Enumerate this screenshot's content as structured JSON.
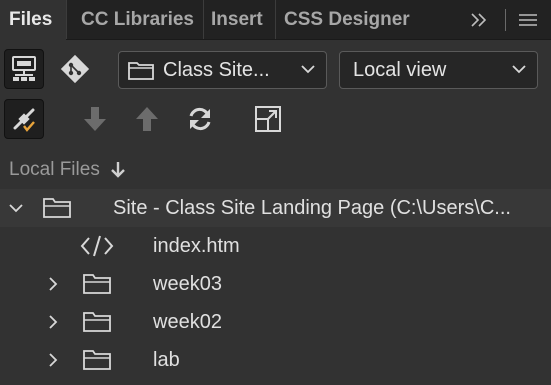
{
  "tabs": [
    {
      "label": "Files",
      "active": true
    },
    {
      "label": "CC Libraries",
      "active": false
    },
    {
      "label": "Insert",
      "active": false
    },
    {
      "label": "CSS Designer",
      "active": false
    }
  ],
  "tab_controls": {
    "expand_icon": "double-chevron-right-icon",
    "menu_icon": "hamburger-menu-icon"
  },
  "toolbar": {
    "site_select": {
      "value": "Class Site..."
    },
    "view_select": {
      "value": "Local view"
    },
    "icons": [
      "connect-server-icon",
      "git-icon",
      "expand-collapse-icon",
      "get-files-icon",
      "put-files-icon",
      "refresh-icon",
      "expand-panel-icon"
    ]
  },
  "local_files": {
    "header": "Local Files",
    "sort_icon": "sort-down-arrow-icon"
  },
  "tree": [
    {
      "label": "Site - Class Site Landing Page (C:\\Users\\C...",
      "type": "site-root",
      "expanded": true
    },
    {
      "label": "index.htm",
      "type": "file"
    },
    {
      "label": "week03",
      "type": "folder",
      "expanded": false
    },
    {
      "label": "week02",
      "type": "folder",
      "expanded": false
    },
    {
      "label": "lab",
      "type": "folder",
      "expanded": false
    }
  ],
  "colors": {
    "panel_bg": "#323232",
    "tabbar_bg": "#222222",
    "text": "#e0e0e0",
    "muted_text": "#9a9a9a",
    "accent_check": "#e8a33a"
  }
}
